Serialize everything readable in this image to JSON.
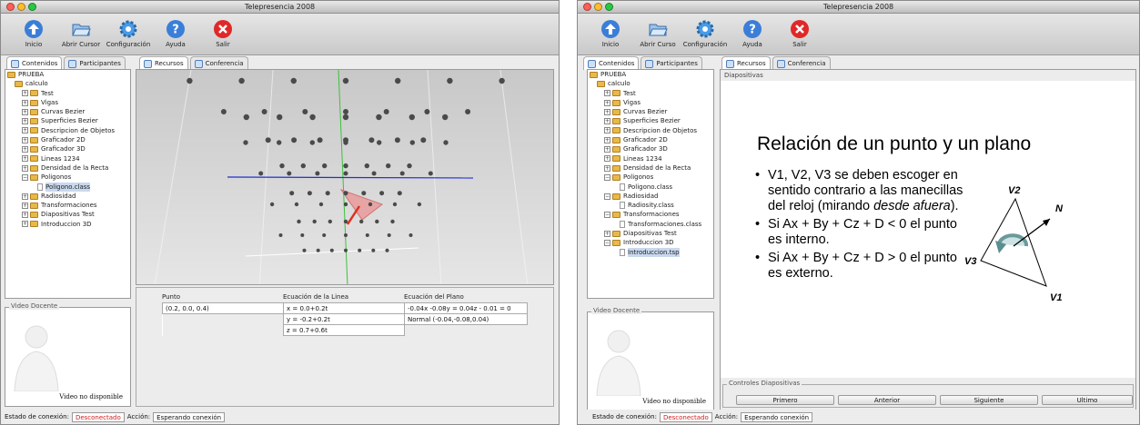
{
  "left_window": {
    "title": "Telepresencia 2008",
    "toolbar": [
      {
        "label": "Inicio",
        "icon": "home-icon"
      },
      {
        "label": "Abrir Cursor",
        "icon": "open-folder-icon"
      },
      {
        "label": "Configuración",
        "icon": "gear-icon"
      },
      {
        "label": "Ayuda",
        "icon": "help-icon"
      },
      {
        "label": "Salir",
        "icon": "exit-icon"
      }
    ],
    "left_tabs": [
      "Contenidos",
      "Participantes"
    ],
    "right_tabs": [
      "Recursos",
      "Conferencia"
    ],
    "tree": [
      {
        "label": "PRUEBA",
        "level": 0,
        "type": "folder"
      },
      {
        "label": "calculo",
        "level": 1,
        "type": "folder",
        "expanded": true
      },
      {
        "label": "Test",
        "level": 2,
        "type": "folder"
      },
      {
        "label": "Vigas",
        "level": 2,
        "type": "folder"
      },
      {
        "label": "Curvas Bezier",
        "level": 2,
        "type": "folder"
      },
      {
        "label": "Superficies Bezier",
        "level": 2,
        "type": "folder"
      },
      {
        "label": "Descripcion de Objetos",
        "level": 2,
        "type": "folder"
      },
      {
        "label": "Graficador 2D",
        "level": 2,
        "type": "folder"
      },
      {
        "label": "Graficador 3D",
        "level": 2,
        "type": "folder"
      },
      {
        "label": "Lineas 1234",
        "level": 2,
        "type": "folder"
      },
      {
        "label": "Densidad de la Recta",
        "level": 2,
        "type": "folder"
      },
      {
        "label": "Poligonos",
        "level": 2,
        "type": "folder",
        "expanded": true
      },
      {
        "label": "Poligono.class",
        "level": 3,
        "type": "file",
        "selected": true
      },
      {
        "label": "Radiosidad",
        "level": 2,
        "type": "folder"
      },
      {
        "label": "Transformaciones",
        "level": 2,
        "type": "folder"
      },
      {
        "label": "Diapositivas Test",
        "level": 2,
        "type": "folder"
      },
      {
        "label": "Introduccion 3D",
        "level": 2,
        "type": "folder"
      }
    ],
    "video": {
      "title": "Video Docente",
      "status": "Video no disponible"
    },
    "table": {
      "headers": [
        "Punto",
        "Ecuación de la Linea",
        "Ecuación del Plano"
      ],
      "rows": [
        [
          "(0.2, 0.0, 0.4)",
          "x = 0.0+0.2t",
          "-0.04x -0.08y = 0.04z - 0.01 = 0"
        ],
        [
          "",
          "y = -0.2+0.2t",
          "Normal (-0.04,-0.08,0.04)"
        ],
        [
          "",
          "z = 0.7+0.6t",
          ""
        ]
      ]
    },
    "status": {
      "label": "Estado de conexión:",
      "value": "Desconectado",
      "action_label": "Acción:",
      "action_value": "Esperando conexión"
    }
  },
  "right_window": {
    "title": "Telepresencia 2008",
    "toolbar": [
      {
        "label": "Inicio",
        "icon": "home-icon"
      },
      {
        "label": "Abrir Curso",
        "icon": "open-folder-icon"
      },
      {
        "label": "Configuración",
        "icon": "gear-icon"
      },
      {
        "label": "Ayuda",
        "icon": "help-icon"
      },
      {
        "label": "Salir",
        "icon": "exit-icon"
      }
    ],
    "left_tabs": [
      "Contenidos",
      "Participantes"
    ],
    "right_tabs": [
      "Recursos",
      "Conferencia"
    ],
    "panel_label": "Diapositivas",
    "tree": [
      {
        "label": "PRUEBA",
        "level": 0,
        "type": "folder"
      },
      {
        "label": "calculo",
        "level": 1,
        "type": "folder",
        "expanded": true
      },
      {
        "label": "Test",
        "level": 2,
        "type": "folder"
      },
      {
        "label": "Vigas",
        "level": 2,
        "type": "folder"
      },
      {
        "label": "Curvas Bezier",
        "level": 2,
        "type": "folder"
      },
      {
        "label": "Superficies Bezier",
        "level": 2,
        "type": "folder"
      },
      {
        "label": "Descripcion de Objetos",
        "level": 2,
        "type": "folder"
      },
      {
        "label": "Graficador 2D",
        "level": 2,
        "type": "folder"
      },
      {
        "label": "Graficador 3D",
        "level": 2,
        "type": "folder"
      },
      {
        "label": "Lineas 1234",
        "level": 2,
        "type": "folder"
      },
      {
        "label": "Densidad de la Recta",
        "level": 2,
        "type": "folder"
      },
      {
        "label": "Poligonos",
        "level": 2,
        "type": "folder",
        "expanded": true
      },
      {
        "label": "Poligono.class",
        "level": 3,
        "type": "file"
      },
      {
        "label": "Radiosidad",
        "level": 2,
        "type": "folder",
        "expanded": true
      },
      {
        "label": "Radiosity.class",
        "level": 3,
        "type": "file"
      },
      {
        "label": "Transformaciones",
        "level": 2,
        "type": "folder",
        "expanded": true
      },
      {
        "label": "Transformaciones.class",
        "level": 3,
        "type": "file"
      },
      {
        "label": "Diapositivas Test",
        "level": 2,
        "type": "folder"
      },
      {
        "label": "Introduccion 3D",
        "level": 2,
        "type": "folder",
        "expanded": true
      },
      {
        "label": "Introduccion.tsp",
        "level": 3,
        "type": "file",
        "selected": true
      }
    ],
    "video": {
      "title": "Video Docente",
      "status": "Video no disponible"
    },
    "slide": {
      "title": "Relación de un punto y un plano",
      "bullets": [
        "V1, V2, V3 se deben escoger en sentido contrario a las manecillas del reloj (mirando desde afuera).",
        "Si Ax + By + Cz + D < 0 el punto es interno.",
        "Si Ax + By + Cz + D > 0 el punto es externo."
      ],
      "labels": {
        "v1": "V1",
        "v2": "V2",
        "v3": "V3",
        "n": "N"
      }
    },
    "controls": {
      "legend": "Controles Diapositivas",
      "buttons": [
        "Primero",
        "Anterior",
        "Siguiente",
        "Ultimo"
      ]
    },
    "status": {
      "label": "Estado de conexión:",
      "value": "Desconectado",
      "action_label": "Acción:",
      "action_value": "Esperando conexión"
    }
  }
}
